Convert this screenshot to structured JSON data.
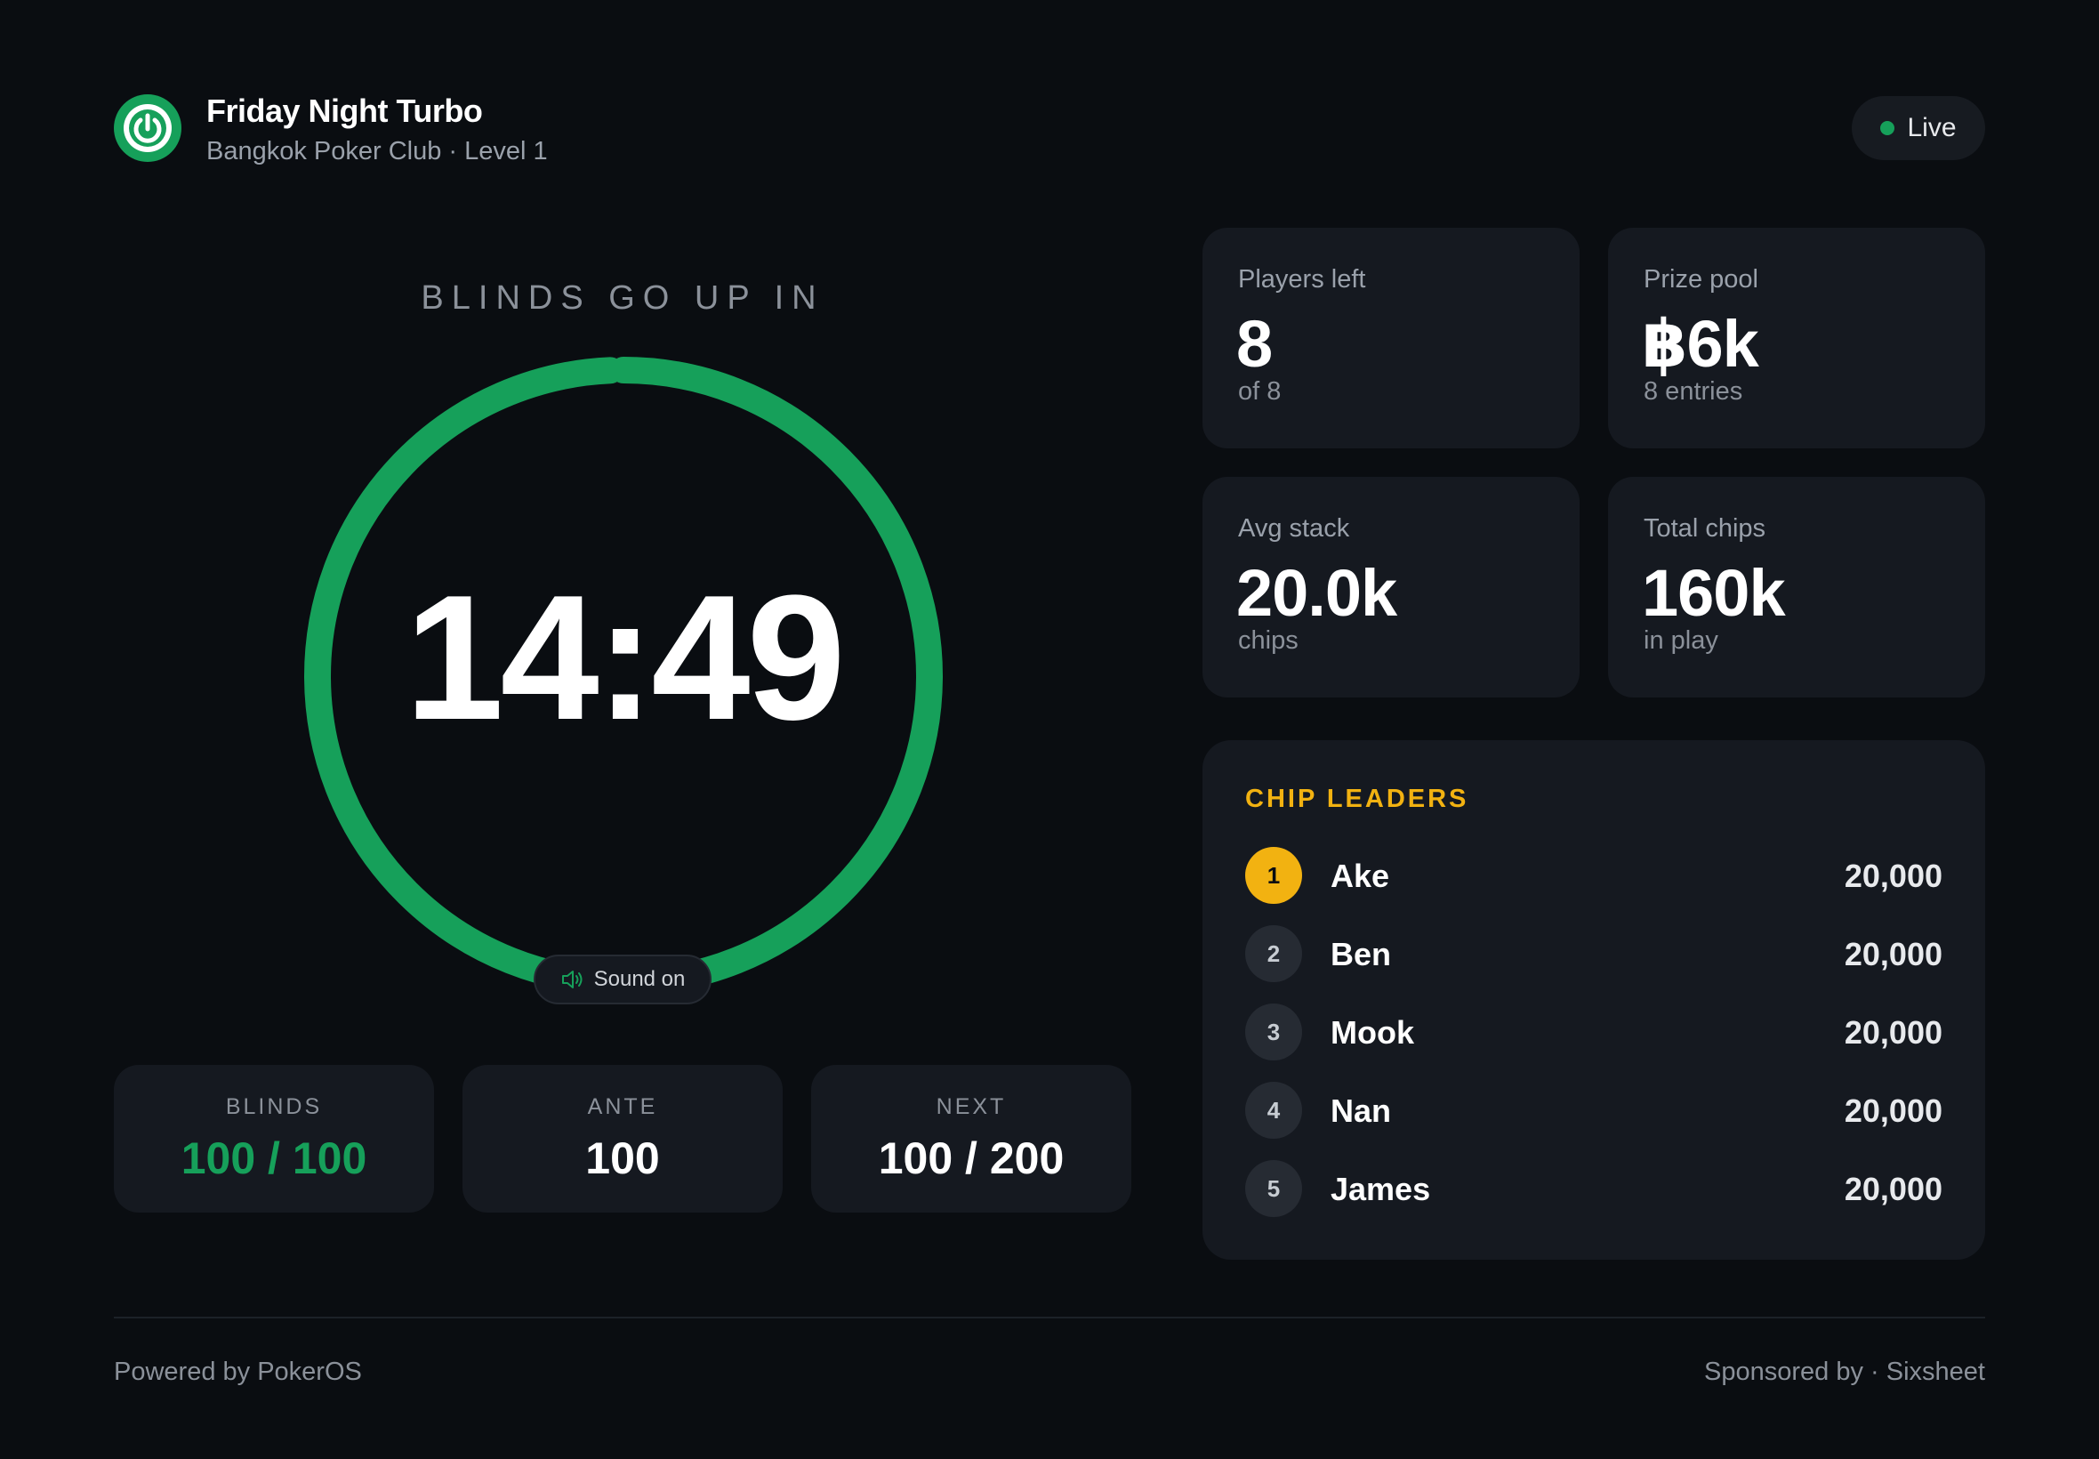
{
  "header": {
    "title": "Friday Night Turbo",
    "subtitle": "Bangkok Poker Club · Level 1",
    "status": "Live",
    "logo_icon": "power-icon"
  },
  "timer": {
    "caption": "BLINDS GO UP IN",
    "time": "14:49",
    "progress": 0.993,
    "sound_label": "Sound on",
    "sound_icon": "speaker-icon"
  },
  "levels": [
    {
      "label": "BLINDS",
      "value": "100 / 100"
    },
    {
      "label": "ANTE",
      "value": "100"
    },
    {
      "label": "NEXT",
      "value": "100 / 200"
    }
  ],
  "stats": [
    {
      "label": "Players left",
      "value": "8",
      "sub": "of 8"
    },
    {
      "label": "Prize pool",
      "value": "฿6k",
      "sub": "8 entries"
    },
    {
      "label": "Avg stack",
      "value": "20.0k",
      "sub": "chips"
    },
    {
      "label": "Total chips",
      "value": "160k",
      "sub": "in play"
    }
  ],
  "leaders": {
    "title": "CHIP LEADERS",
    "rows": [
      {
        "rank": "1",
        "name": "Ake",
        "chips": "20,000"
      },
      {
        "rank": "2",
        "name": "Ben",
        "chips": "20,000"
      },
      {
        "rank": "3",
        "name": "Mook",
        "chips": "20,000"
      },
      {
        "rank": "4",
        "name": "Nan",
        "chips": "20,000"
      },
      {
        "rank": "5",
        "name": "James",
        "chips": "20,000"
      }
    ]
  },
  "footer": {
    "left": "Powered by PokerOS",
    "right": "Sponsored by · Sixsheet"
  },
  "colors": {
    "background": "#0a0d11",
    "panel": "#151920",
    "accent_green": "#16a05a",
    "accent_gold": "#f2b211"
  }
}
